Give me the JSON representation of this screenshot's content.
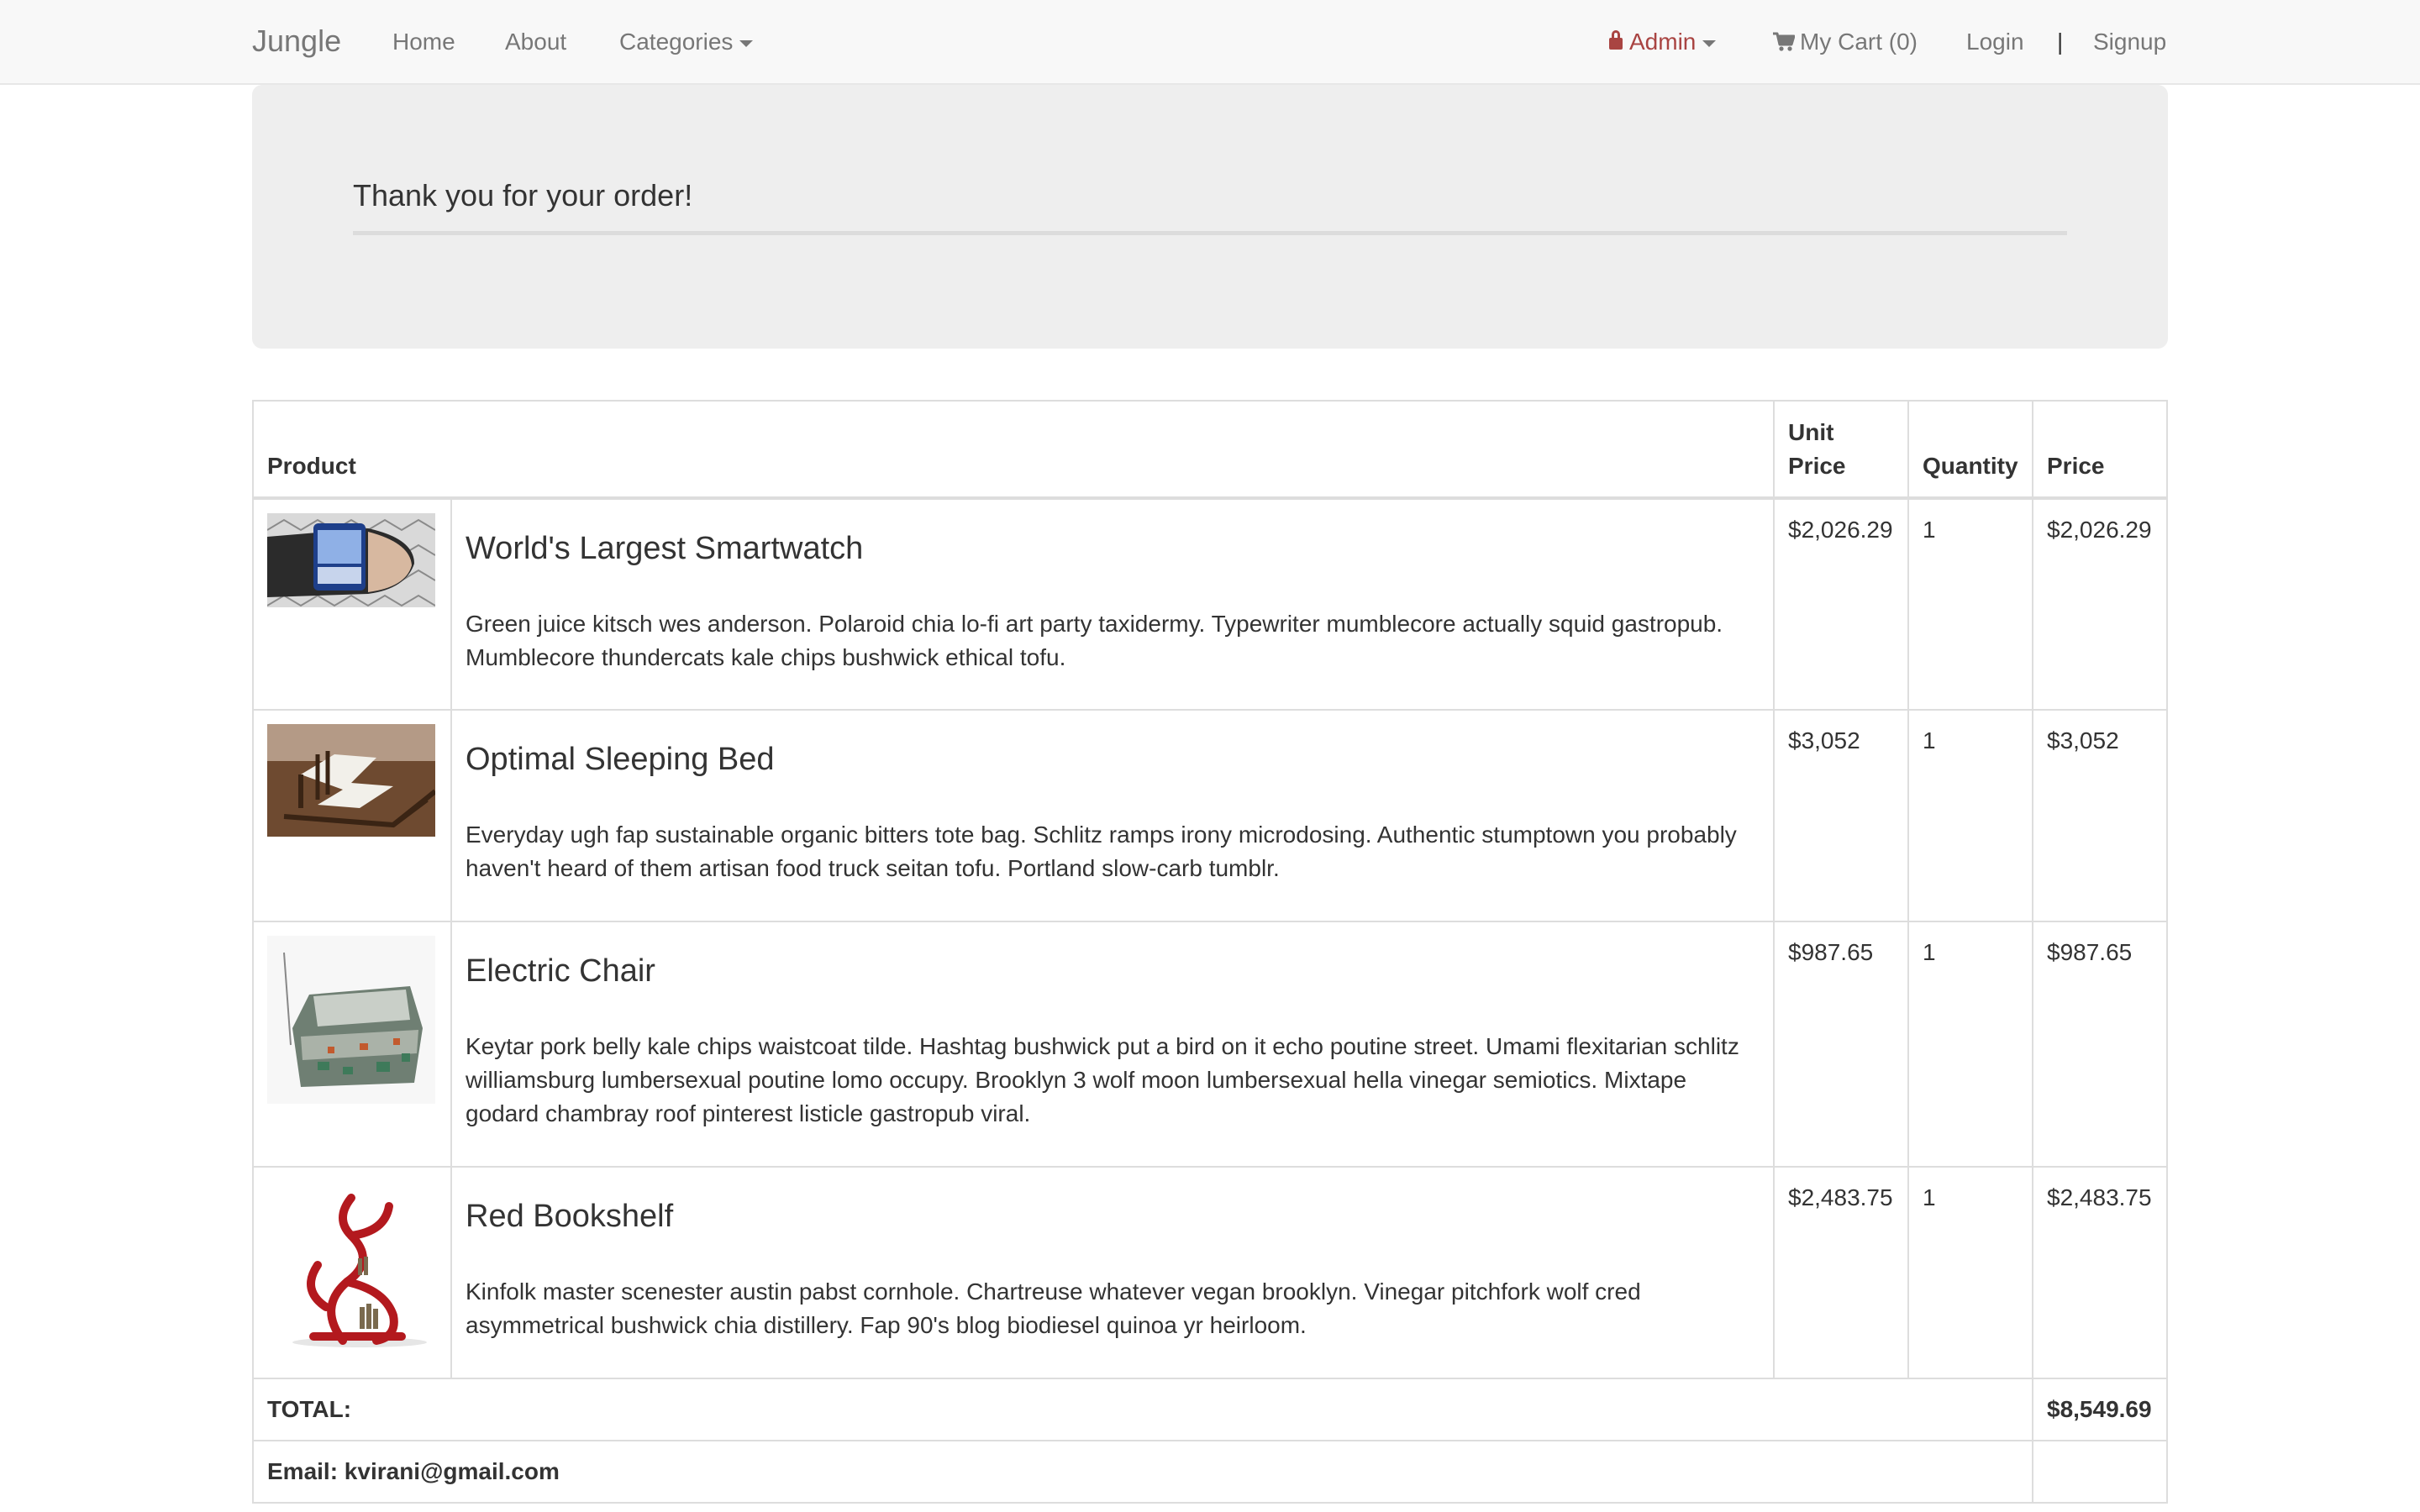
{
  "navbar": {
    "brand": "Jungle",
    "links": {
      "home": "Home",
      "about": "About",
      "categories": "Categories"
    },
    "admin": "Admin",
    "cart": "My Cart (0)",
    "login": "Login",
    "separator": "|",
    "signup": "Signup",
    "colors": {
      "admin": "#a94442",
      "link": "#777777"
    }
  },
  "jumbotron": {
    "title": "Thank you for your order!"
  },
  "table": {
    "headers": {
      "product": "Product",
      "unit_price": "Unit Price",
      "quantity": "Quantity",
      "price": "Price"
    },
    "rows": [
      {
        "name": "World's Largest Smartwatch",
        "description": "Green juice kitsch wes anderson. Polaroid chia lo-fi art party taxidermy. Typewriter mumblecore actually squid gastropub. Mumblecore thundercats kale chips bushwick ethical tofu.",
        "unit_price": "$2,026.29",
        "quantity": "1",
        "price": "$2,026.29",
        "image": "smartwatch-on-wrist"
      },
      {
        "name": "Optimal Sleeping Bed",
        "description": "Everyday ugh fap sustainable organic bitters tote bag. Schlitz ramps irony microdosing. Authentic stumptown you probably haven't heard of them artisan food truck seitan tofu. Portland slow-carb tumblr.",
        "unit_price": "$3,052",
        "quantity": "1",
        "price": "$3,052",
        "image": "zigzag-bed"
      },
      {
        "name": "Electric Chair",
        "description": "Keytar pork belly kale chips waistcoat tilde. Hashtag bushwick put a bird on it echo poutine street. Umami flexitarian schlitz williamsburg lumbersexual poutine lomo occupy. Brooklyn 3 wolf moon lumbersexual hella vinegar semiotics. Mixtape godard chambray roof pinterest listicle gastropub viral.",
        "unit_price": "$987.65",
        "quantity": "1",
        "price": "$987.65",
        "image": "circuit-board-armchair"
      },
      {
        "name": "Red Bookshelf",
        "description": "Kinfolk master scenester austin pabst cornhole. Chartreuse whatever vegan brooklyn. Vinegar pitchfork wolf cred asymmetrical bushwick chia distillery. Fap 90's blog biodiesel quinoa yr heirloom.",
        "unit_price": "$2,483.75",
        "quantity": "1",
        "price": "$2,483.75",
        "image": "red-tree-bookshelf"
      }
    ],
    "total_label": "TOTAL:",
    "total_value": "$8,549.69",
    "email_label": "Email: kvirani@gmail.com"
  }
}
